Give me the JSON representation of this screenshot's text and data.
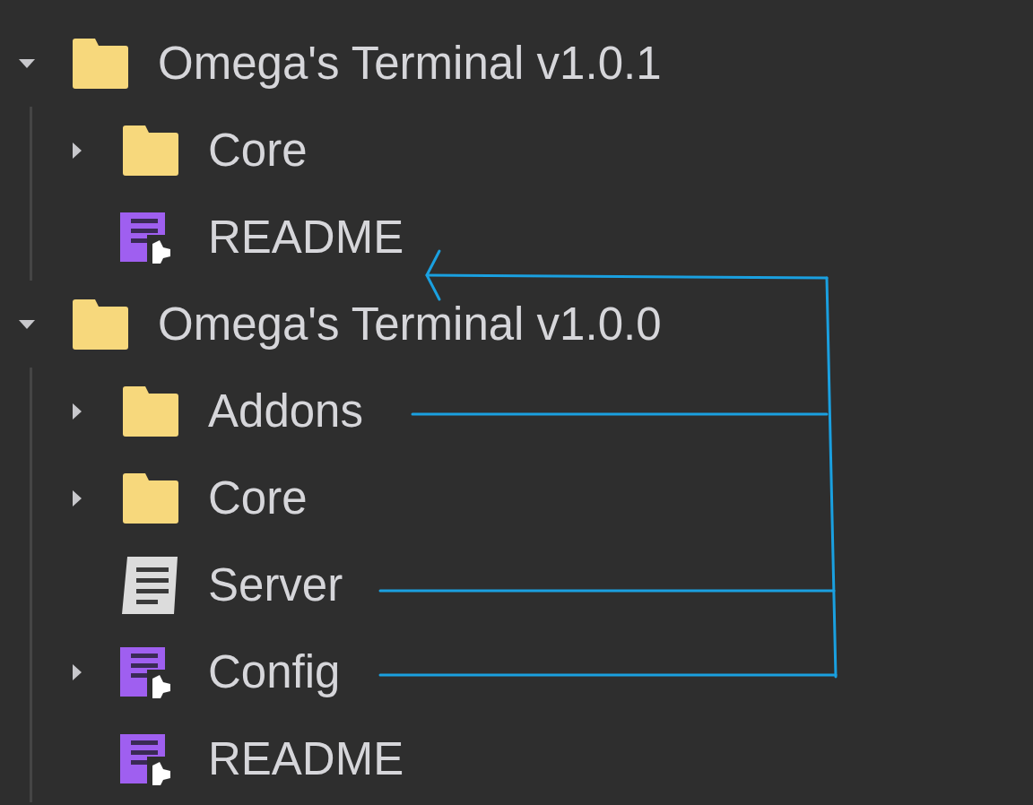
{
  "tree": [
    {
      "kind": "folder",
      "label": "Omega's Terminal v1.0.1",
      "expanded": true,
      "children": [
        {
          "kind": "folder",
          "label": "Core",
          "expanded": false
        },
        {
          "kind": "module",
          "label": "README"
        }
      ]
    },
    {
      "kind": "folder",
      "label": "Omega's Terminal v1.0.0",
      "expanded": true,
      "children": [
        {
          "kind": "folder",
          "label": "Addons",
          "expanded": false
        },
        {
          "kind": "folder",
          "label": "Core",
          "expanded": false
        },
        {
          "kind": "script",
          "label": "Server"
        },
        {
          "kind": "module",
          "label": "Config",
          "expanded": false
        },
        {
          "kind": "module",
          "label": "README"
        }
      ]
    }
  ]
}
